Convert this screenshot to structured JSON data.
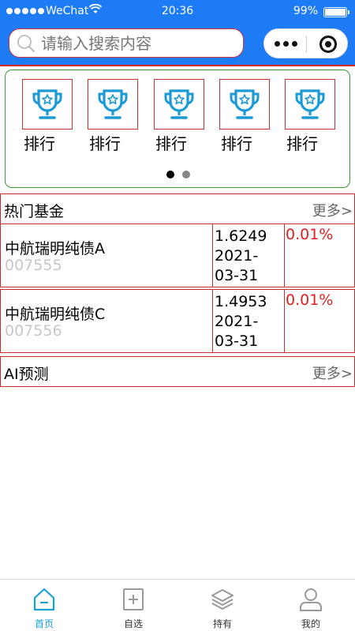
{
  "status_bar": {
    "carrier": "WeChat",
    "time": "20:36",
    "battery": "99%",
    "battery_level": 0.99
  },
  "search": {
    "placeholder": "请输入搜索内容"
  },
  "ranking": {
    "items": [
      {
        "label": "排行"
      },
      {
        "label": "排行"
      },
      {
        "label": "排行"
      },
      {
        "label": "排行"
      },
      {
        "label": "排行"
      }
    ],
    "page_count": 2,
    "active_page": 1
  },
  "hot_funds": {
    "title": "热门基金",
    "more": "更多>",
    "rows": [
      {
        "name": "中航瑞明纯债A",
        "code": "007555",
        "nav": "1.6249",
        "date": "2021-03-31",
        "change": "0.01%"
      },
      {
        "name": "中航瑞明纯债C",
        "code": "007556",
        "nav": "1.4953",
        "date": "2021-03-31",
        "change": "0.01%"
      }
    ]
  },
  "ai_forecast": {
    "title": "AI预测",
    "more": "更多>"
  },
  "tabbar": {
    "tabs": [
      {
        "label": "首页",
        "icon": "home-icon",
        "active": true
      },
      {
        "label": "自选",
        "icon": "add-icon",
        "active": false
      },
      {
        "label": "持有",
        "icon": "layers-icon",
        "active": false
      },
      {
        "label": "我的",
        "icon": "user-icon",
        "active": false
      }
    ]
  },
  "colors": {
    "brand_blue": "#1e7bf6",
    "accent_red": "#e02020",
    "active_tab": "#1aa0d6"
  }
}
